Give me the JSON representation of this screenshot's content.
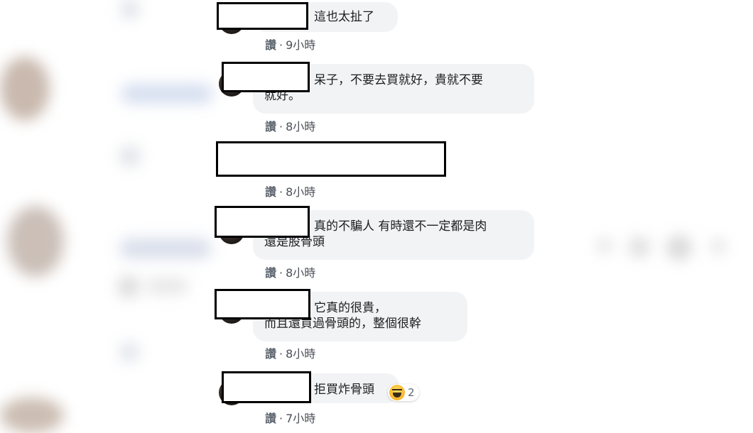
{
  "comments": [
    {
      "text": "這也太扯了",
      "like_label": "讚",
      "separator": "·",
      "time": "9小時"
    },
    {
      "text": "呆子，不要去買就好，貴就不要\n就好。",
      "like_label": "讚",
      "separator": "·",
      "time": "8小時"
    },
    {
      "text": "",
      "like_label": "讚",
      "separator": "·",
      "time": "8小時"
    },
    {
      "text": "真的不騙人 有時還不一定都是肉\n還是股骨頭",
      "like_label": "讚",
      "separator": "·",
      "time": "8小時"
    },
    {
      "text": "它真的很貴，\n而且還買過骨頭的，整個很幹",
      "like_label": "讚",
      "separator": "·",
      "time": "8小時"
    },
    {
      "text": "拒買炸骨頭",
      "like_label": "讚",
      "separator": "·",
      "time": "7小時",
      "reaction": {
        "icon": "haha-icon",
        "count": "2"
      }
    }
  ],
  "colors": {
    "bubble": "#f2f3f5",
    "redaction_border": "#000000",
    "meta_text": "#4b4f56"
  }
}
